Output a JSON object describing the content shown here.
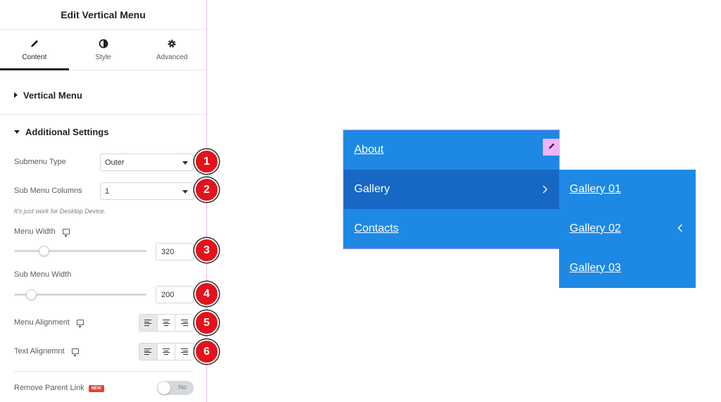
{
  "panel": {
    "title": "Edit Vertical Menu",
    "tabs": [
      {
        "label": "Content",
        "icon": "pencil-icon",
        "active": true
      },
      {
        "label": "Style",
        "icon": "contrast-icon",
        "active": false
      },
      {
        "label": "Advanced",
        "icon": "gear-icon",
        "active": false
      }
    ],
    "sections": {
      "vertical_menu": "Vertical Menu",
      "additional_settings": "Additional Settings"
    },
    "fields": {
      "submenu_type": {
        "label": "Submenu Type",
        "value": "Outer"
      },
      "sub_menu_columns": {
        "label": "Sub Menu Columns",
        "value": "1",
        "note": "It's just work for Desktop Device."
      },
      "menu_width": {
        "label": "Menu Width",
        "value": "320",
        "slider_fraction": 0.2
      },
      "sub_menu_width": {
        "label": "Sub Menu Width",
        "value": "200",
        "slider_fraction": 0.1
      },
      "menu_alignment": {
        "label": "Menu Alignment",
        "selected": "left"
      },
      "text_alignment": {
        "label": "Text Alignemnt",
        "selected": "left"
      },
      "remove_parent_link": {
        "label": "Remove Parent Link",
        "badge": "NEW",
        "toggle": "No"
      }
    },
    "markers": [
      "1",
      "2",
      "3",
      "4",
      "5",
      "6"
    ]
  },
  "preview": {
    "menu_items": [
      "About",
      "Gallery",
      "Contacts"
    ],
    "submenu_items": [
      "Gallery 01",
      "Gallery 02",
      "Gallery 03"
    ],
    "colors": {
      "menu_bg": "#1e88e5",
      "hover_bg": "#1767c4",
      "outline": "#d58af0",
      "marker": "#e4121b"
    }
  }
}
